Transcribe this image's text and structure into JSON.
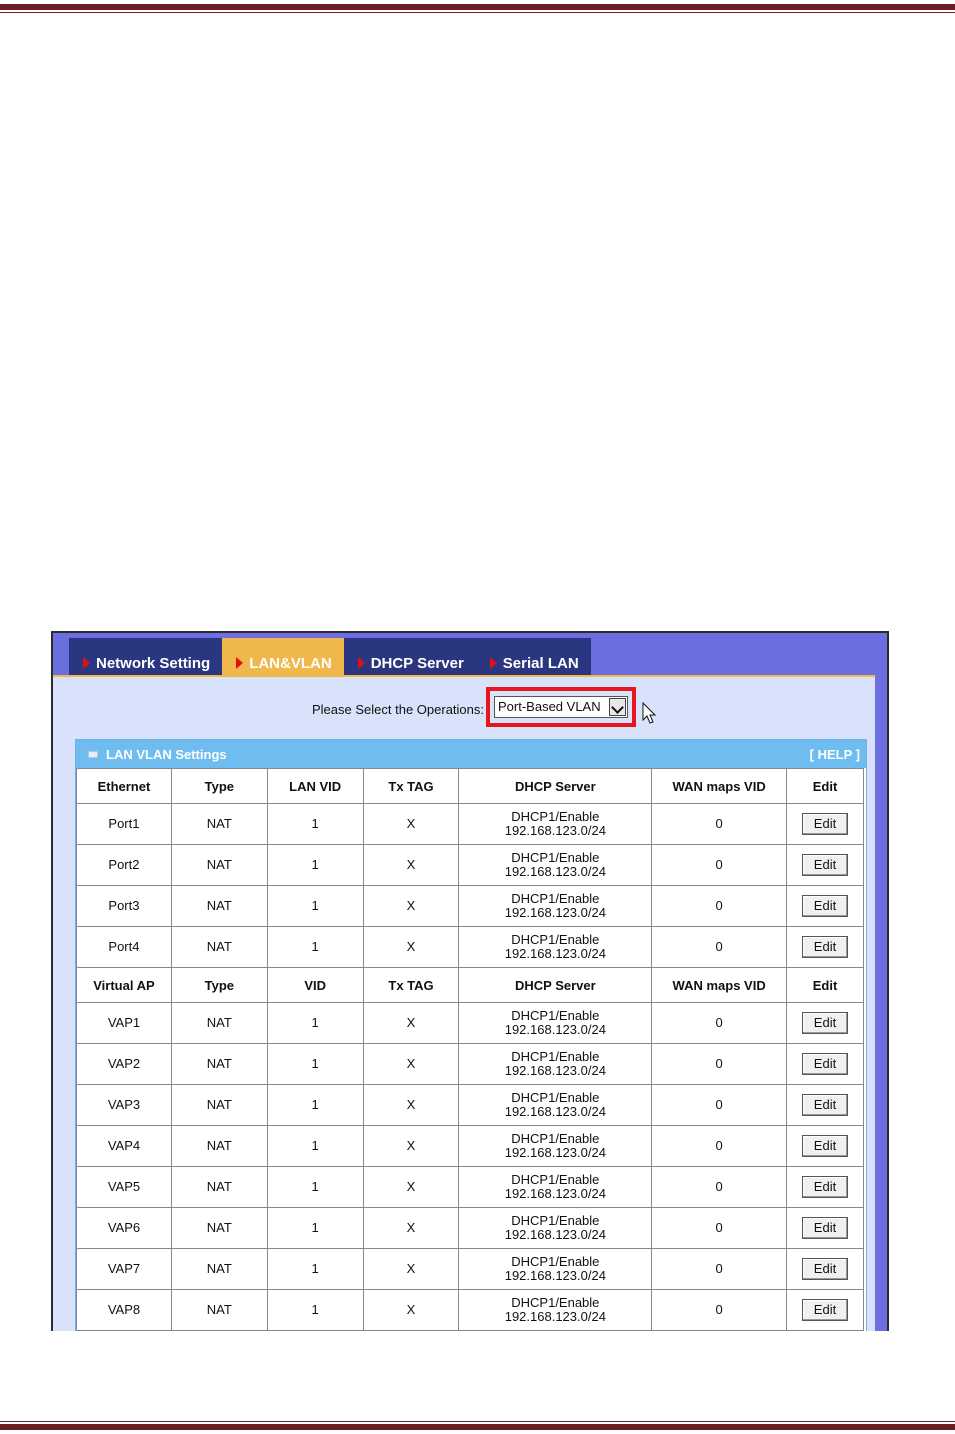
{
  "tabs": [
    {
      "label": "Network Setting",
      "active": false
    },
    {
      "label": "LAN&VLAN",
      "active": true
    },
    {
      "label": "DHCP Server",
      "active": false
    },
    {
      "label": "Serial LAN",
      "active": false
    }
  ],
  "operations": {
    "label": "Please Select the Operations:",
    "selected": "Port-Based VLAN"
  },
  "panel": {
    "title": "LAN VLAN Settings",
    "help": "[ HELP ]"
  },
  "ethernet_headers": [
    "Ethernet",
    "Type",
    "LAN VID",
    "Tx TAG",
    "DHCP Server",
    "WAN maps VID",
    "Edit"
  ],
  "ethernet_rows": [
    {
      "name": "Port1",
      "type": "NAT",
      "vid": "1",
      "tx": "X",
      "dhcp1": "DHCP1/Enable",
      "dhcp2": "192.168.123.0/24",
      "wan": "0",
      "edit": "Edit"
    },
    {
      "name": "Port2",
      "type": "NAT",
      "vid": "1",
      "tx": "X",
      "dhcp1": "DHCP1/Enable",
      "dhcp2": "192.168.123.0/24",
      "wan": "0",
      "edit": "Edit"
    },
    {
      "name": "Port3",
      "type": "NAT",
      "vid": "1",
      "tx": "X",
      "dhcp1": "DHCP1/Enable",
      "dhcp2": "192.168.123.0/24",
      "wan": "0",
      "edit": "Edit"
    },
    {
      "name": "Port4",
      "type": "NAT",
      "vid": "1",
      "tx": "X",
      "dhcp1": "DHCP1/Enable",
      "dhcp2": "192.168.123.0/24",
      "wan": "0",
      "edit": "Edit"
    }
  ],
  "vap_headers": [
    "Virtual AP",
    "Type",
    "VID",
    "Tx TAG",
    "DHCP Server",
    "WAN maps VID",
    "Edit"
  ],
  "vap_rows": [
    {
      "name": "VAP1",
      "type": "NAT",
      "vid": "1",
      "tx": "X",
      "dhcp1": "DHCP1/Enable",
      "dhcp2": "192.168.123.0/24",
      "wan": "0",
      "edit": "Edit"
    },
    {
      "name": "VAP2",
      "type": "NAT",
      "vid": "1",
      "tx": "X",
      "dhcp1": "DHCP1/Enable",
      "dhcp2": "192.168.123.0/24",
      "wan": "0",
      "edit": "Edit"
    },
    {
      "name": "VAP3",
      "type": "NAT",
      "vid": "1",
      "tx": "X",
      "dhcp1": "DHCP1/Enable",
      "dhcp2": "192.168.123.0/24",
      "wan": "0",
      "edit": "Edit"
    },
    {
      "name": "VAP4",
      "type": "NAT",
      "vid": "1",
      "tx": "X",
      "dhcp1": "DHCP1/Enable",
      "dhcp2": "192.168.123.0/24",
      "wan": "0",
      "edit": "Edit"
    },
    {
      "name": "VAP5",
      "type": "NAT",
      "vid": "1",
      "tx": "X",
      "dhcp1": "DHCP1/Enable",
      "dhcp2": "192.168.123.0/24",
      "wan": "0",
      "edit": "Edit"
    },
    {
      "name": "VAP6",
      "type": "NAT",
      "vid": "1",
      "tx": "X",
      "dhcp1": "DHCP1/Enable",
      "dhcp2": "192.168.123.0/24",
      "wan": "0",
      "edit": "Edit"
    },
    {
      "name": "VAP7",
      "type": "NAT",
      "vid": "1",
      "tx": "X",
      "dhcp1": "DHCP1/Enable",
      "dhcp2": "192.168.123.0/24",
      "wan": "0",
      "edit": "Edit"
    },
    {
      "name": "VAP8",
      "type": "NAT",
      "vid": "1",
      "tx": "X",
      "dhcp1": "DHCP1/Enable",
      "dhcp2": "192.168.123.0/24",
      "wan": "0",
      "edit": "Edit"
    }
  ],
  "colors": {
    "page_rule": "#6b1f24",
    "tab_bar": "#6b6fe0",
    "tab": "#2a3680",
    "tab_active": "#f0b84a",
    "content_bg": "#d8e2fb",
    "panel_header": "#6fbdf0",
    "highlight": "#e8141e"
  },
  "icons": {
    "tab_marker": "red-triangle-arrow-icon",
    "panel": "panel-icon",
    "cursor": "mouse-pointer-icon"
  }
}
